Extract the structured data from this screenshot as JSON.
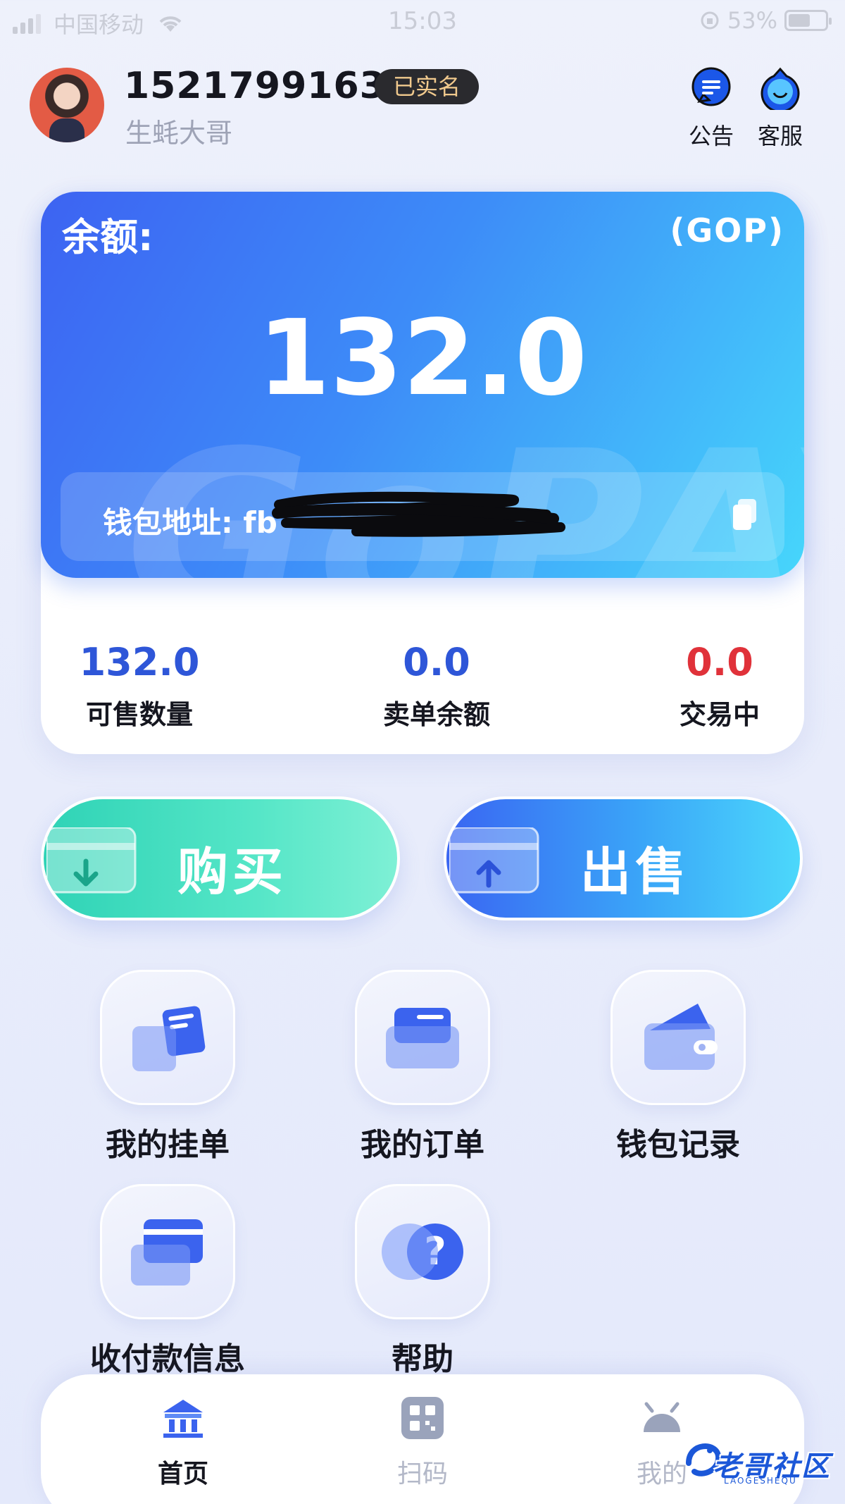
{
  "status_bar": {
    "carrier": "中国移动",
    "time": "15:03",
    "battery": "53%",
    "battery_level": 0.53
  },
  "user": {
    "phone": "15217991631",
    "verified_badge": "已实名",
    "nickname": "生蚝大哥"
  },
  "header_actions": [
    {
      "label": "公告",
      "icon": "announcement-chat-icon"
    },
    {
      "label": "客服",
      "icon": "customer-service-icon"
    }
  ],
  "balance_card": {
    "label": "余额:",
    "unit": "(GOP)",
    "value": "132.0",
    "watermark": "GoPAY",
    "address_label": "钱包地址: fb",
    "address_redacted": true
  },
  "stats": [
    {
      "value": "132.0",
      "label": "可售数量",
      "color": "#2e56d8"
    },
    {
      "value": "0.0",
      "label": "卖单余额",
      "color": "#2e56d8"
    },
    {
      "value": "0.0",
      "label": "交易中",
      "color": "#e0323a"
    }
  ],
  "trade_buttons": {
    "buy": "购买",
    "sell": "出售"
  },
  "grid": [
    {
      "label": "我的挂单",
      "icon": "listing-cards-icon"
    },
    {
      "label": "我的订单",
      "icon": "folder-icon"
    },
    {
      "label": "钱包记录",
      "icon": "wallet-icon"
    },
    {
      "label": "收付款信息",
      "icon": "payment-cards-icon"
    },
    {
      "label": "帮助",
      "icon": "help-question-icon"
    }
  ],
  "bottom_nav": [
    {
      "label": "首页",
      "icon": "bank-home-icon",
      "active": true
    },
    {
      "label": "扫码",
      "icon": "qr-scan-icon",
      "active": false
    },
    {
      "label": "我的",
      "icon": "profile-icon",
      "active": false
    }
  ],
  "watermark_overlay": {
    "text": "老哥社区",
    "sub": "LAOGESHEQU"
  },
  "colors": {
    "accent_blue": "#3d63f2",
    "buy_green": "#2fd3b6",
    "sell_blue": "#3aa5f8",
    "danger_red": "#e0323a",
    "badge_gold": "#f0c98d"
  }
}
